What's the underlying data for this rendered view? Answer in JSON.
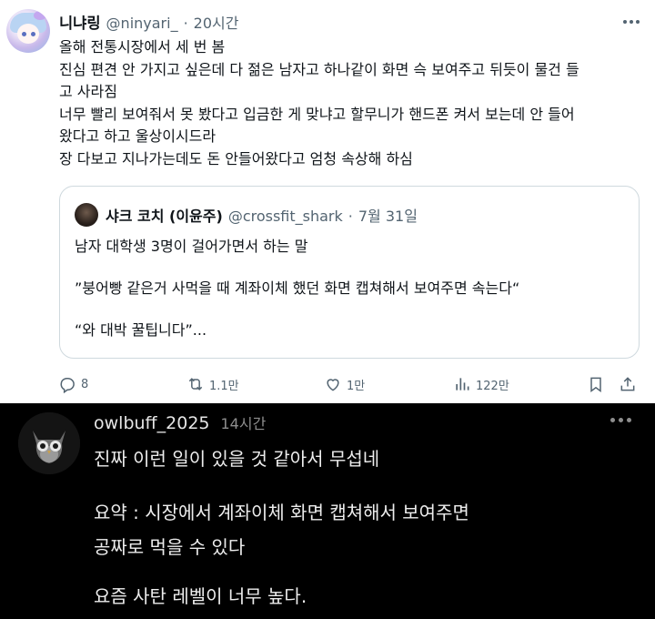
{
  "tweet": {
    "author_name": "니냐링",
    "handle": "@ninyari_",
    "separator": "·",
    "time": "20시간",
    "lines": [
      "올해 전통시장에서 세 번 봄",
      "진심 편견 안 가지고 싶은데 다 젊은 남자고 하나같이 화면 슥 보여주고 뒤듯이 물건 들",
      "고 사라짐",
      "너무 빨리 보여줘서 못 봤다고 입금한 게 맞냐고 할무니가 핸드폰 켜서 보는데 안 들어",
      "왔다고 하고 울상이시드라",
      "장 다보고 지나가는데도 돈 안들어왔다고 엄청 속상해 하심"
    ],
    "quote": {
      "author_name": "샤크 코치 (이윤주)",
      "handle": "@crossfit_shark",
      "separator": "·",
      "date": "7월 31일",
      "lines": [
        "남자 대학생 3명이 걸어가면서 하는 말",
        "”붕어빵 같은거 사먹을 때 계좌이체 했던 화면 캡쳐해서 보여주면 속는다“",
        "“와 대박 꿀팁니다”..."
      ]
    },
    "actions": {
      "replies": "8",
      "retweets": "1.1만",
      "likes": "1만",
      "views": "122만"
    }
  },
  "comment": {
    "username": "owlbuff_2025",
    "time": "14시간",
    "paragraphs": [
      "진짜 이런 일이 있을 것 같아서 무섭네",
      "요약 : 시장에서 계좌이체 화면 캡쳐해서 보여주면",
      "공짜로 먹을 수 있다",
      "요즘 사탄 레벨이 너무 높다."
    ]
  },
  "icons": [
    "reply-icon",
    "retweet-icon",
    "like-icon",
    "views-icon",
    "bookmark-icon",
    "share-icon",
    "more-icon"
  ],
  "colors": {
    "text": "#0f1419",
    "muted": "#536471",
    "border": "#cfd9de",
    "dark_bg": "#000000"
  }
}
